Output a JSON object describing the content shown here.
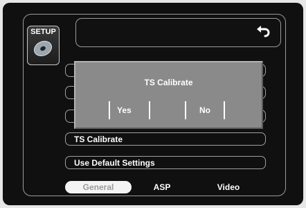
{
  "badge": {
    "label": "SETUP",
    "icon": "disc-icon"
  },
  "header": {
    "back_icon": "back-arrow-icon"
  },
  "menu": {
    "items": [
      {
        "label": ""
      },
      {
        "label": ""
      },
      {
        "label": ""
      },
      {
        "label": "TS Calibrate"
      },
      {
        "label": "Use Default Settings"
      }
    ]
  },
  "dialog": {
    "title": "TS Calibrate",
    "yes_label": "Yes",
    "no_label": "No"
  },
  "tabs": [
    {
      "label": "General",
      "selected": true
    },
    {
      "label": "ASP",
      "selected": false
    },
    {
      "label": "Video",
      "selected": false
    }
  ],
  "colors": {
    "background": "#101010",
    "dialog": "#8a8a8a",
    "selected_tab": "#f4f4f4"
  }
}
